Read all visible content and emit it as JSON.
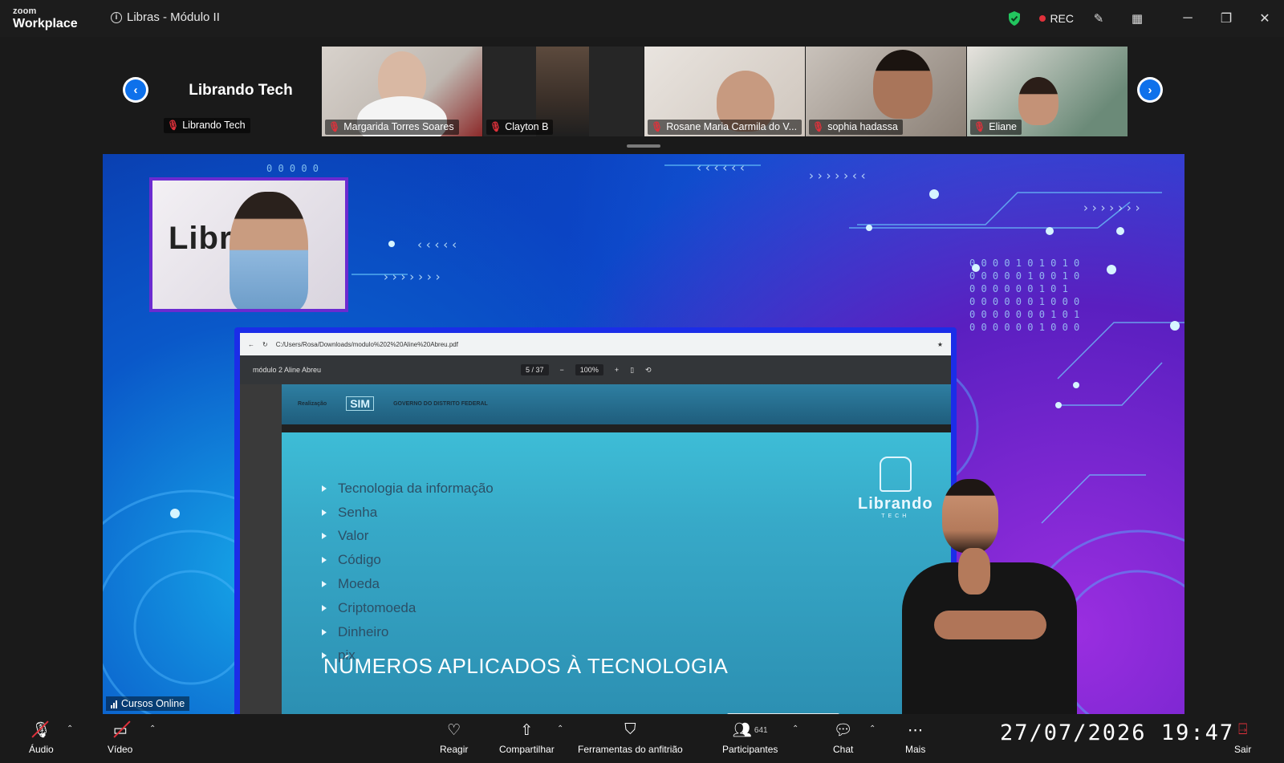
{
  "titlebar": {
    "brand_small": "zoom",
    "brand_big": "Workplace",
    "meeting_title": "Libras - Módulo II",
    "rec_label": "REC",
    "encryption_color": "#22c55e",
    "rec_color": "#e0313b"
  },
  "gallery": {
    "host": {
      "display_name": "Librando Tech",
      "tag": "Librando Tech"
    },
    "participants": [
      {
        "name": "Margarida Torres Soares"
      },
      {
        "name": "Clayton B"
      },
      {
        "name": "Rosane Maria Carmila do V..."
      },
      {
        "name": "sophia hadassa"
      },
      {
        "name": "Eliane"
      }
    ]
  },
  "share": {
    "source_label": "Cursos Online",
    "host_video_text": "Libra",
    "browser": {
      "url": "C:/Users/Rosa/Downloads/modulo%202%20Aline%20Abreu.pdf",
      "file_name": "módulo 2 Aline Abreu",
      "page": "5 / 37",
      "zoom": "100%"
    },
    "slide": {
      "header_left": "Realização",
      "header_mid": "SIM",
      "header_right": "GOVERNO DO DISTRITO FEDERAL",
      "bullets": [
        "Tecnologia da informação",
        "Senha",
        "Valor",
        "Código",
        "Moeda",
        "Criptomoeda",
        "Dinheiro",
        "pix"
      ],
      "title": "NÚMEROS APLICADOS À TECNOLOGIA",
      "logo_name": "Librando",
      "logo_sub": "TECH"
    }
  },
  "toolbar": {
    "audio": "Áudio",
    "video": "Vídeo",
    "react": "Reagir",
    "share": "Compartilhar",
    "host_tools": "Ferramentas do anfitrião",
    "participants": "Participantes",
    "participants_count": "641",
    "chat": "Chat",
    "more": "Mais",
    "leave": "Sair",
    "datetime": "27/07/2026  19:47"
  }
}
